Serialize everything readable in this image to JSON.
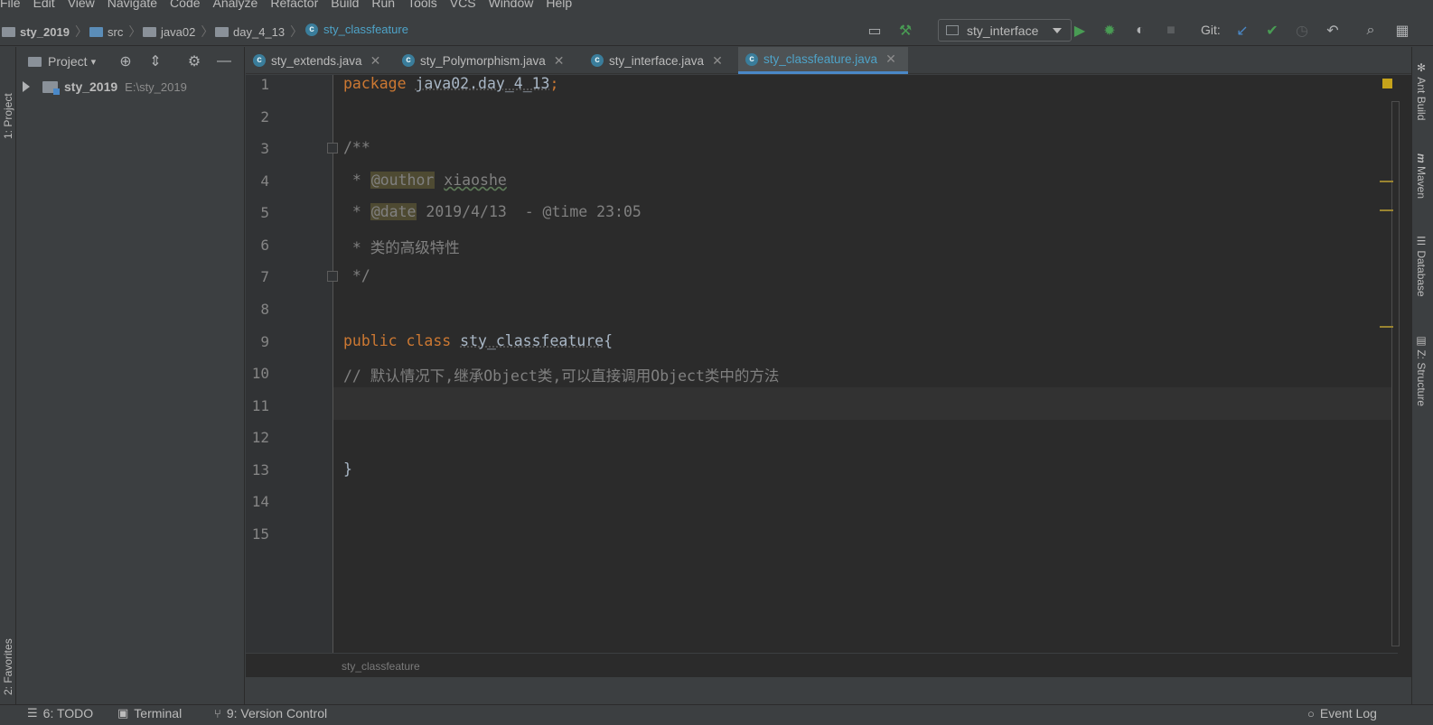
{
  "menu": [
    "File",
    "Edit",
    "View",
    "Navigate",
    "Code",
    "Analyze",
    "Refactor",
    "Build",
    "Run",
    "Tools",
    "VCS",
    "Window",
    "Help"
  ],
  "breadcrumbs": [
    {
      "label": "sty_2019",
      "icon": "project-folder-icon"
    },
    {
      "label": "src",
      "icon": "source-folder-icon"
    },
    {
      "label": "java02",
      "icon": "package-folder-icon"
    },
    {
      "label": "day_4_13",
      "icon": "package-folder-icon"
    },
    {
      "label": "sty_classfeature",
      "icon": "class-icon"
    }
  ],
  "run_config": {
    "label": "sty_interface"
  },
  "git_label": "Git:",
  "project_panel": {
    "title": "Project",
    "tree": {
      "name": "sty_2019",
      "path": "E:\\sty_2019"
    }
  },
  "tabs": [
    {
      "label": "sty_extends.java",
      "active": false
    },
    {
      "label": "sty_Polymorphism.java",
      "active": false
    },
    {
      "label": "sty_interface.java",
      "active": false
    },
    {
      "label": "sty_classfeature.java",
      "active": true
    }
  ],
  "editor": {
    "line_numbers": [
      "1",
      "2",
      "3",
      "4",
      "5",
      "6",
      "7",
      "8",
      "9",
      "10",
      "11",
      "12",
      "13",
      "14",
      "15"
    ],
    "current_line": 11,
    "code": {
      "l1_kw": "package",
      "l1_pkg": "java02.day_4_13",
      "l1_semi": ";",
      "l3": "/**",
      "l4_star": " * ",
      "l4_tag": "@outhor",
      "l4_val": "xiaoshe",
      "l5_star": " * ",
      "l5_tag": "@date",
      "l5_val": " 2019/4/13  - @time 23:05",
      "l6": " * 类的高级特性",
      "l7": " */",
      "l9_kw": "public class ",
      "l9_name": "sty_classfeature",
      "l9_brace": "{",
      "l10": "// 默认情况下,继承Object类,可以直接调用Object类中的方法",
      "l13": "}"
    },
    "breadcrumb": "sty_classfeature"
  },
  "left_stripe": {
    "project": "1: Project",
    "favorites": "2: Favorites"
  },
  "right_stripe": [
    "Ant Build",
    "Maven",
    "Database",
    "Z: Structure"
  ],
  "bottom": {
    "todo": "6: TODO",
    "terminal": "Terminal",
    "vcs": "9: Version Control",
    "event_log": "Event Log"
  },
  "colors": {
    "accent": "#4a88c7",
    "run": "#499c54",
    "keyword": "#cc7832"
  }
}
